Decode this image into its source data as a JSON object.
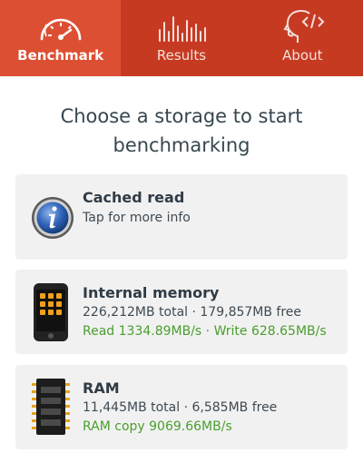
{
  "tabs": [
    {
      "label": "Benchmark",
      "icon": "speedometer-icon",
      "active": true
    },
    {
      "label": "Results",
      "icon": "bar-chart-icon",
      "active": false
    },
    {
      "label": "About",
      "icon": "head-code-icon",
      "active": false
    }
  ],
  "heading": "Choose a storage to start benchmarking",
  "cards": [
    {
      "title": "Cached read",
      "line1": "Tap for more info",
      "icon": "info-icon"
    },
    {
      "title": "Internal memory",
      "line1": "226,212MB total · 179,857MB free",
      "line2": "Read 1334.89MB/s · Write 628.65MB/s",
      "icon": "phone-icon"
    },
    {
      "title": "RAM",
      "line1": "11,445MB total · 6,585MB free",
      "line2": "RAM copy 9069.66MB/s",
      "icon": "ram-chip-icon"
    }
  ],
  "colors": {
    "tabbar": "#c73a22",
    "active_tab": "#dd4f33",
    "card_bg": "#f1f1f1",
    "green_text": "#4a9e2e",
    "heading_text": "#37474f"
  }
}
